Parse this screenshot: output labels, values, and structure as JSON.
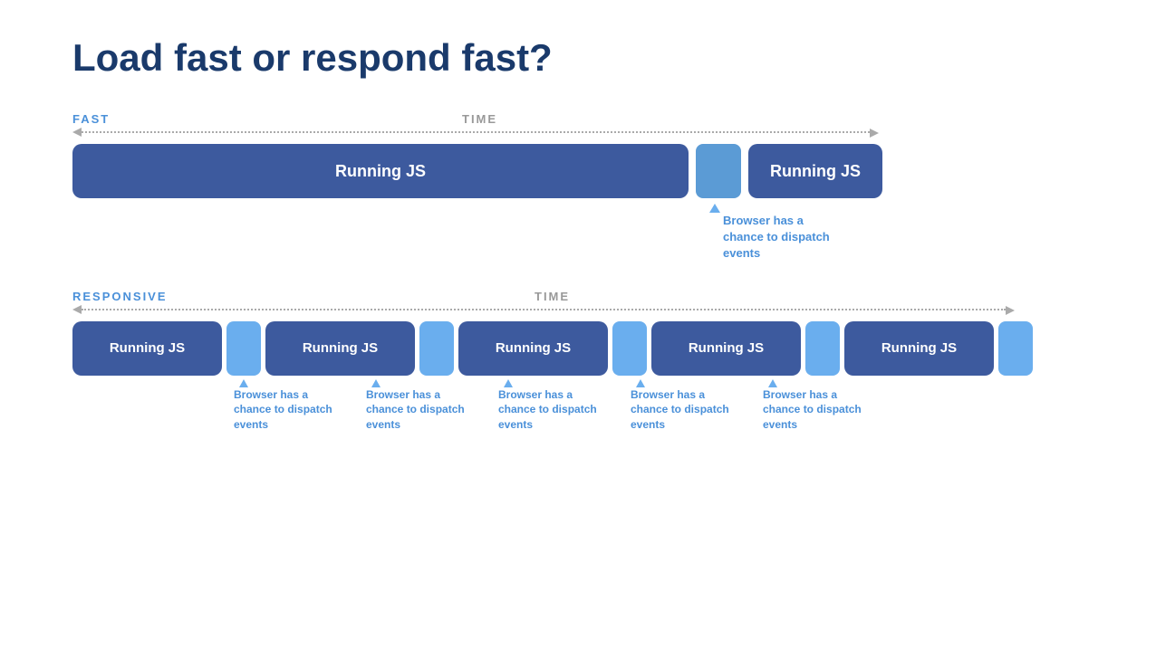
{
  "title": "Load fast or respond fast?",
  "fast_section": {
    "label": "FAST",
    "time_label": "TIME",
    "running_js_label": "Running JS",
    "annotation_text": "Browser has a chance to dispatch events"
  },
  "responsive_section": {
    "label": "RESPONSIVE",
    "time_label": "TIME",
    "running_js_label": "Running JS",
    "annotation_text": "Browser has a chance to dispatch events",
    "annotations_count": 5
  },
  "colors": {
    "js_block": "#3d5a9e",
    "gap_block": "#6aaeee",
    "annotation_text": "#4a90d9",
    "title": "#1a3a6b",
    "section_label": "#4a90d9",
    "time_label": "#999999",
    "arrow": "#aaaaaa"
  }
}
